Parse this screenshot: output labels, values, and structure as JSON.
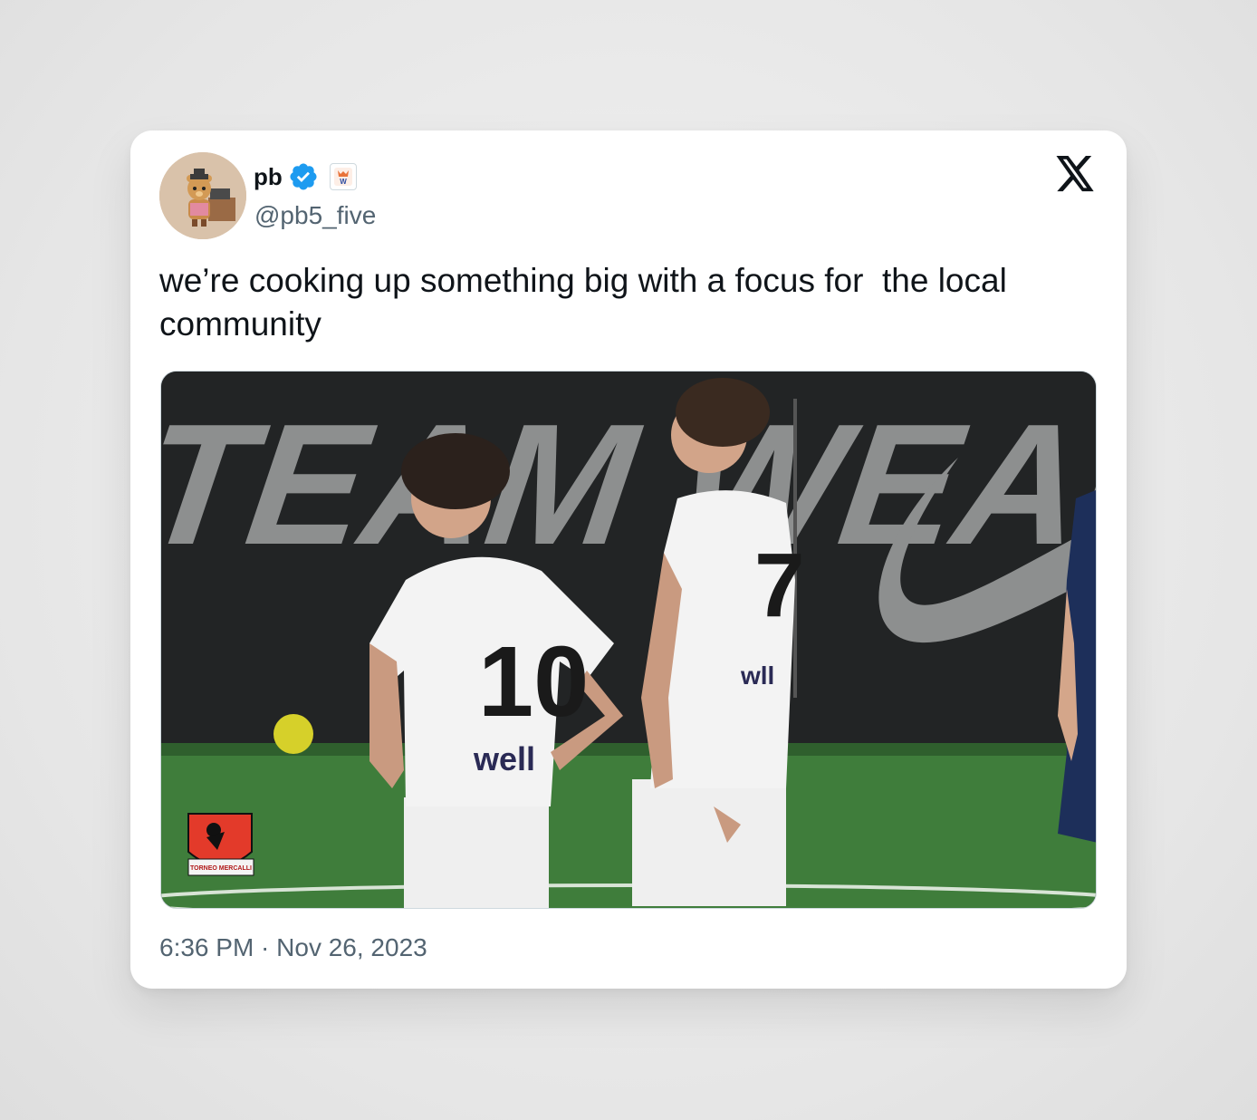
{
  "tweet": {
    "author": {
      "display_name": "pb",
      "handle": "@pb5_five",
      "verified": true,
      "affiliate_badge_letter": "W",
      "avatar": "bear-character-avatar"
    },
    "text": "we’re cooking up something big with a focus for  the local community",
    "timestamp": "6:36 PM · Nov 26, 2023",
    "media": {
      "description_icons": [
        "team-wear-banner",
        "nike-swoosh",
        "players"
      ],
      "banner_text": "TEAM WEAR",
      "jersey_numbers": [
        "10",
        "7"
      ],
      "sponsor_text": [
        "well",
        "wll"
      ],
      "watermark": "TORNEO MERCALLI"
    }
  },
  "colors": {
    "verified_blue": "#1d9bf0",
    "text_primary": "#0f1419",
    "text_secondary": "#536471",
    "pitch_green": "#3a7a3a"
  }
}
